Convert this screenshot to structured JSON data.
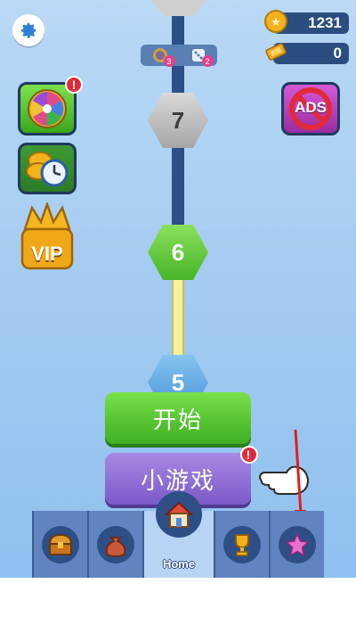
{
  "currency": {
    "coins": "1231",
    "tickets": "0"
  },
  "inventory": [
    {
      "icon": "magnet-icon",
      "count": "3"
    },
    {
      "icon": "dice-icon",
      "count": "2"
    }
  ],
  "levels": {
    "upper": "7",
    "current": "6",
    "lower": "5"
  },
  "side_buttons": {
    "vip_label": "VIP",
    "ads_label": "ADS"
  },
  "buttons": {
    "start": "开始",
    "minigame": "小游戏"
  },
  "badges": {
    "alert": "!"
  },
  "bottom_nav": {
    "home_label": "Home",
    "tabs": [
      "chest-icon",
      "bag-icon",
      "home-icon",
      "trophy-icon",
      "star-icon"
    ]
  },
  "colors": {
    "track": "#2c4f86",
    "start_green": "#4cbf2a",
    "minigame_purple": "#8a69d3",
    "alert_red": "#e02a3c"
  }
}
